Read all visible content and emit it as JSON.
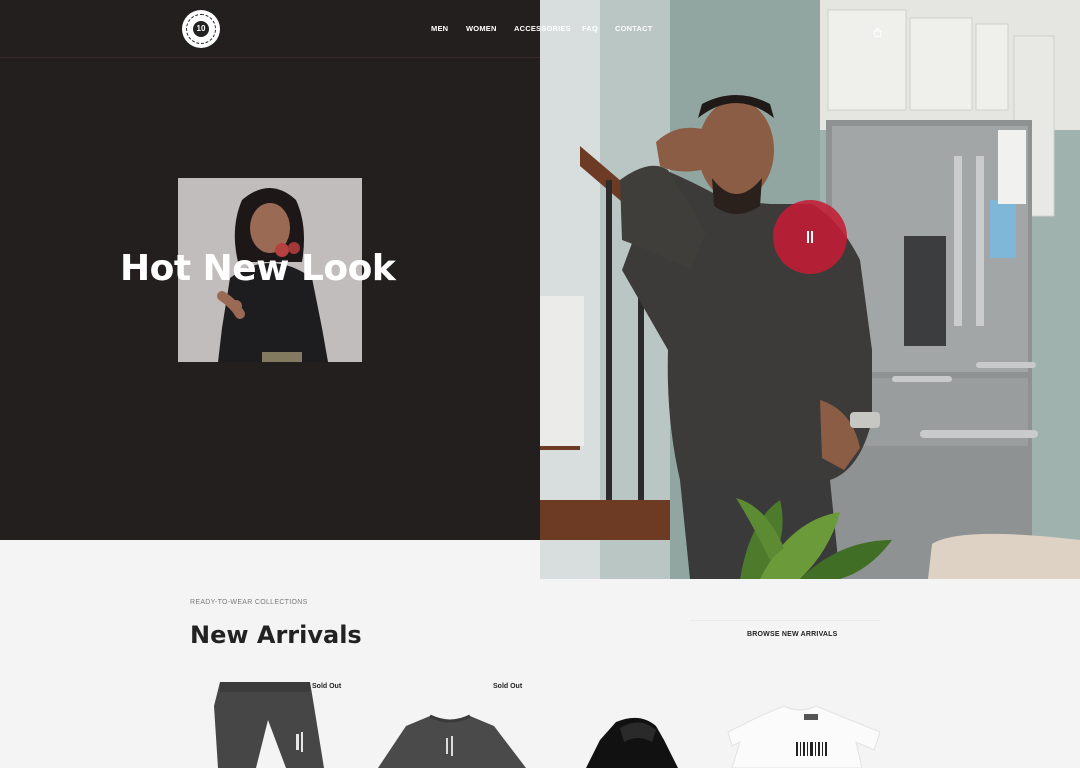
{
  "brand": {
    "logo_text": "10"
  },
  "nav": {
    "items": [
      {
        "label": "MEN"
      },
      {
        "label": "WOMEN"
      },
      {
        "label": "ACCESSORIES"
      },
      {
        "label": "FAQ"
      },
      {
        "label": "CONTACT"
      }
    ]
  },
  "icons": {
    "cart": "shopping-bag-icon",
    "pause": "pause-icon",
    "logo": "brand-seal-logo"
  },
  "hero": {
    "title": "Hot New Look"
  },
  "colors": {
    "hero_dark": "#231f1f",
    "accent": "#c41c34",
    "page_bg": "#f4f4f4"
  },
  "arrivals": {
    "eyebrow": "READY-TO-WEAR COLLECTIONS",
    "title": "New Arrivals",
    "browse_label": "BROWSE NEW ARRIVALS",
    "products": [
      {
        "badge": "Sold Out"
      },
      {
        "badge": "Sold Out"
      },
      {
        "badge": ""
      },
      {
        "badge": ""
      }
    ]
  }
}
